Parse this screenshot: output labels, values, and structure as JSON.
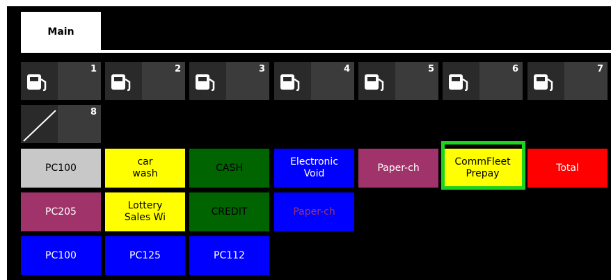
{
  "tabs": [
    {
      "label": "Main"
    }
  ],
  "pumps": [
    {
      "number": "1",
      "icon": "fuel-pump-icon"
    },
    {
      "number": "2",
      "icon": "fuel-pump-icon"
    },
    {
      "number": "3",
      "icon": "fuel-pump-icon"
    },
    {
      "number": "4",
      "icon": "fuel-pump-icon"
    },
    {
      "number": "5",
      "icon": "fuel-pump-icon"
    },
    {
      "number": "6",
      "icon": "fuel-pump-icon"
    },
    {
      "number": "7",
      "icon": "fuel-pump-icon"
    },
    {
      "number": "8",
      "icon": "disabled-slash-icon"
    }
  ],
  "buttons": [
    {
      "label": "PC100",
      "bg": "#c8c8c8",
      "fg": "#000000"
    },
    {
      "label": "car\nwash",
      "bg": "#ffff00",
      "fg": "#000000"
    },
    {
      "label": "CASH",
      "bg": "#006400",
      "fg": "#000000"
    },
    {
      "label": "Electronic\nVoid",
      "bg": "#0000ff",
      "fg": "#ffffff"
    },
    {
      "label": "Paper-ch",
      "bg": "#a0336a",
      "fg": "#ffffff"
    },
    {
      "label": "CommFleet\nPrepay",
      "bg": "#ffff00",
      "fg": "#000000"
    },
    {
      "label": "Total",
      "bg": "#ff0000",
      "fg": "#ffffff"
    },
    {
      "label": "PC205",
      "bg": "#a0336a",
      "fg": "#ffffff"
    },
    {
      "label": "Lottery\nSales Wi",
      "bg": "#ffff00",
      "fg": "#000000"
    },
    {
      "label": "CREDIT",
      "bg": "#006400",
      "fg": "#000000"
    },
    {
      "label": "Paper-ch",
      "bg": "#0000ff",
      "fg": "#a0336a"
    },
    {
      "label": "PC100",
      "bg": "#0000ff",
      "fg": "#ffffff"
    },
    {
      "label": "PC125",
      "bg": "#0000ff",
      "fg": "#ffffff"
    },
    {
      "label": "PC112",
      "bg": "#0000ff",
      "fg": "#ffffff"
    }
  ],
  "highlight_color": "#1ed31e"
}
